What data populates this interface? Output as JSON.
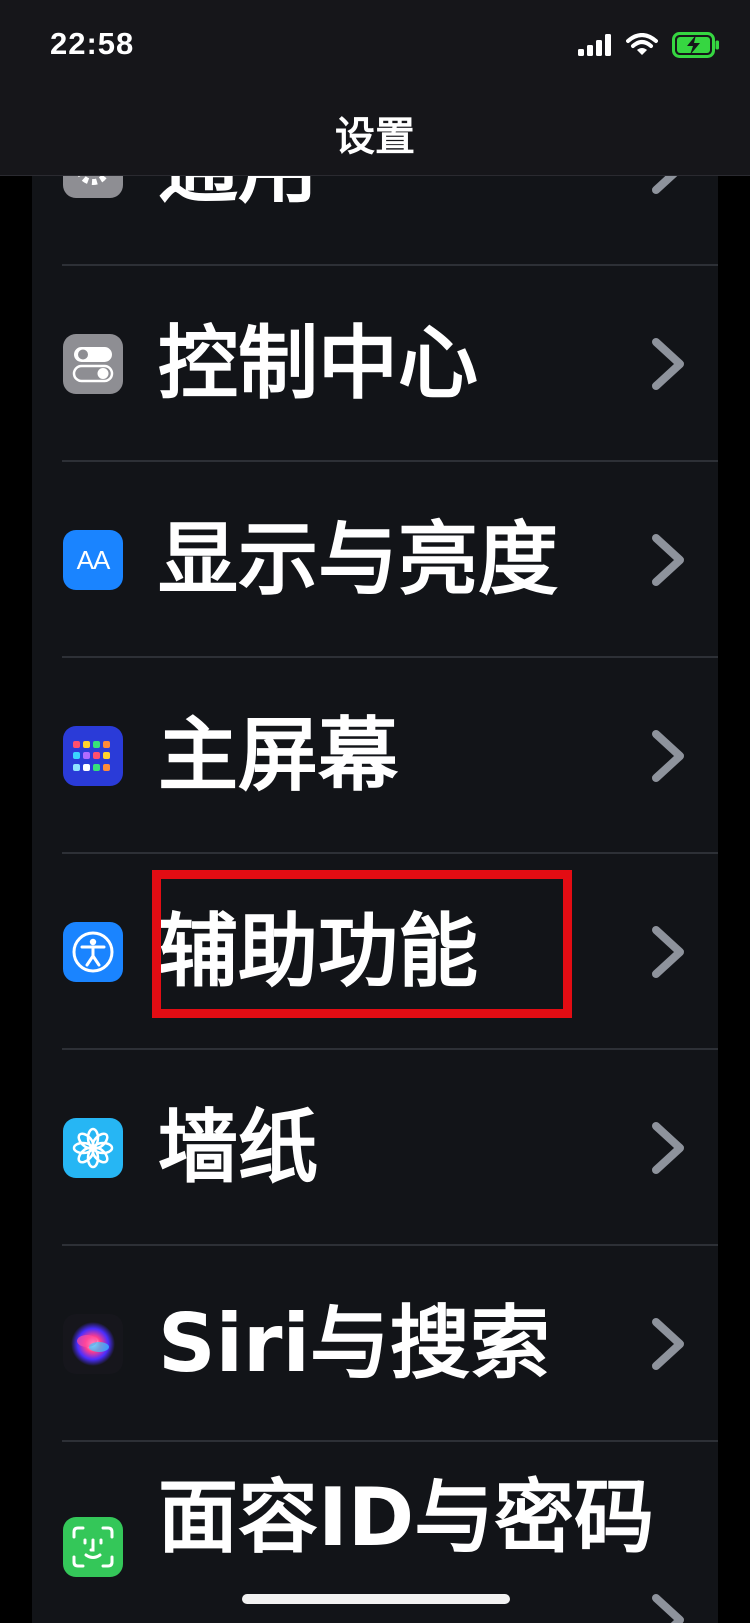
{
  "status_bar": {
    "time": "22:58"
  },
  "nav": {
    "title": "设置"
  },
  "list": {
    "items": [
      {
        "label": "通用"
      },
      {
        "label": "控制中心"
      },
      {
        "label": "显示与亮度",
        "icon_text": "AA"
      },
      {
        "label": "主屏幕"
      },
      {
        "label": "辅助功能"
      },
      {
        "label": "墙纸"
      },
      {
        "label": "Siri与搜索"
      },
      {
        "label": "面容ID与密码"
      }
    ]
  },
  "colors": {
    "background": "#121418",
    "highlight": "#e30c13",
    "chevron": "#8e939c",
    "battery": "#36d641"
  }
}
